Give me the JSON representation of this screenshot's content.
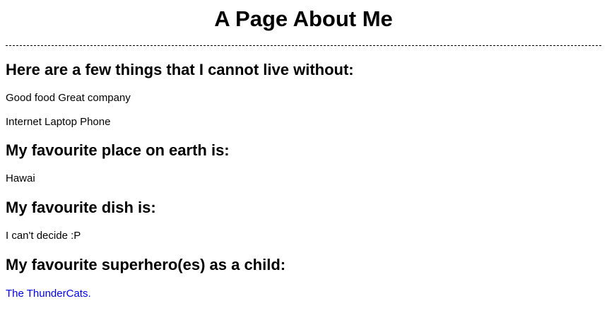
{
  "page": {
    "title": "A Page About Me"
  },
  "sections": [
    {
      "heading": "Here are a few things that I cannot live without:",
      "lines": [
        "Good food Great company",
        "Internet Laptop Phone"
      ]
    },
    {
      "heading": "My favourite place on earth is:",
      "lines": [
        "Hawai"
      ]
    },
    {
      "heading": "My favourite dish is:",
      "lines": [
        "I can't decide :P"
      ]
    },
    {
      "heading": "My favourite superhero(es) as a child:",
      "link": "The ThunderCats.",
      "link_color": "#0000ee"
    }
  ]
}
